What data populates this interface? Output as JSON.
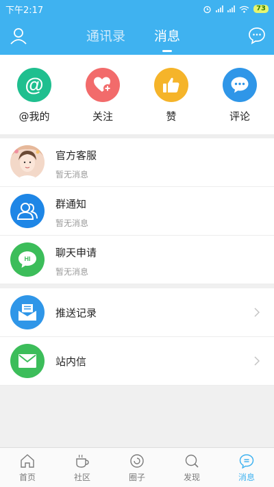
{
  "status_bar": {
    "time": "下午2:17",
    "battery": "73"
  },
  "header": {
    "tabs": [
      {
        "label": "通讯录",
        "active": false
      },
      {
        "label": "消息",
        "active": true
      }
    ],
    "profile_icon": "person-icon",
    "chat_icon": "chat-bubble-icon"
  },
  "quick_actions": [
    {
      "label": "@我的",
      "icon": "at-icon",
      "color": "#1fbf8f"
    },
    {
      "label": "关注",
      "icon": "heart-plus-icon",
      "color": "#f26b6b"
    },
    {
      "label": "赞",
      "icon": "thumbs-up-icon",
      "color": "#f5b42a"
    },
    {
      "label": "评论",
      "icon": "comment-icon",
      "color": "#2f96e8"
    }
  ],
  "messages": [
    {
      "title": "官方客服",
      "subtitle": "暂无消息",
      "icon": "avatar-photo"
    },
    {
      "title": "群通知",
      "subtitle": "暂无消息",
      "icon": "group-icon",
      "color": "#1e86e6"
    },
    {
      "title": "聊天申请",
      "subtitle": "暂无消息",
      "icon": "hi-bubble-icon",
      "color": "#3cbd5a"
    }
  ],
  "links": [
    {
      "title": "推送记录",
      "icon": "inbox-icon",
      "color": "#2f96e8"
    },
    {
      "title": "站内信",
      "icon": "mail-icon",
      "color": "#3cbd5a"
    }
  ],
  "hi_text": "HI",
  "bottom_nav": [
    {
      "label": "首页",
      "icon": "home-icon",
      "active": false
    },
    {
      "label": "社区",
      "icon": "cup-icon",
      "active": false
    },
    {
      "label": "圈子",
      "icon": "circle-icon",
      "active": false
    },
    {
      "label": "发现",
      "icon": "search-icon",
      "active": false
    },
    {
      "label": "消息",
      "icon": "message-icon",
      "active": true
    }
  ],
  "colors": {
    "primary": "#3fb2f0"
  }
}
